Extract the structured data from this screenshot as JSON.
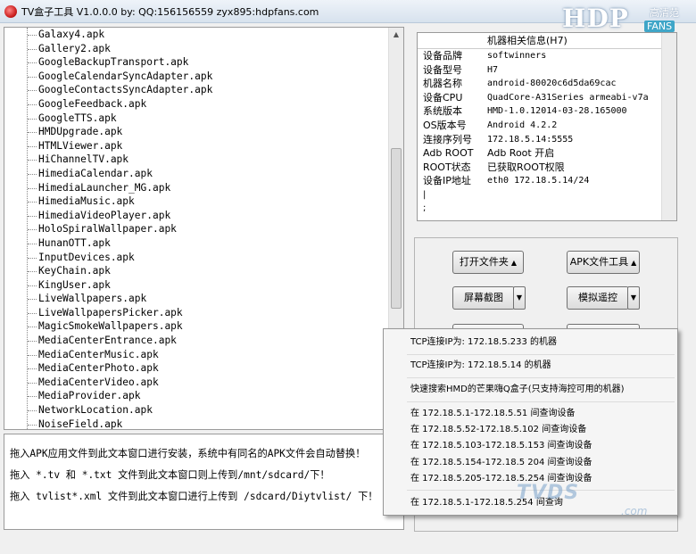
{
  "window": {
    "title": "TV盒子工具 V1.0.0.0 by: QQ:156156559  zyx895:hdpfans.com"
  },
  "logo": {
    "main": "HDP",
    "chinese": "高清范",
    "fans": "FANS"
  },
  "apk_list": [
    "Galaxy4.apk",
    "Gallery2.apk",
    "GoogleBackupTransport.apk",
    "GoogleCalendarSyncAdapter.apk",
    "GoogleContactsSyncAdapter.apk",
    "GoogleFeedback.apk",
    "GoogleTTS.apk",
    "HMDUpgrade.apk",
    "HTMLViewer.apk",
    "HiChannelTV.apk",
    "HimediaCalendar.apk",
    "HimediaLauncher_MG.apk",
    "HimediaMusic.apk",
    "HimediaVideoPlayer.apk",
    "HoloSpiralWallpaper.apk",
    "HunanOTT.apk",
    "InputDevices.apk",
    "KeyChain.apk",
    "KingUser.apk",
    "LiveWallpapers.apk",
    "LiveWallpapersPicker.apk",
    "MagicSmokeWallpapers.apk",
    "MediaCenterEntrance.apk",
    "MediaCenterMusic.apk",
    "MediaCenterPhoto.apk",
    "MediaCenterVideo.apk",
    "MediaProvider.apk",
    "NetworkLocation.apk",
    "NoiseField.apk"
  ],
  "instructions": {
    "line1": "拖入APK应用文件到此文本窗口进行安装，系统中有同名的APK文件会自动替换！",
    "line2": "拖入 *.tv 和 *.txt 文件到此文本窗口则上传到/mnt/sdcard/下！",
    "line3": "拖入 tvlist*.xml 文件到此文本窗口进行上传到 /sdcard/Diytvlist/ 下！"
  },
  "device_info": {
    "header": "机器相关信息(H7)",
    "rows": [
      {
        "label": "设备品牌",
        "value": "softwinners"
      },
      {
        "label": "设备型号",
        "value": "H7"
      },
      {
        "label": "机器名称",
        "value": "android-80020c6d5da69cac"
      },
      {
        "label": "设备CPU",
        "value": "QuadCore-A31Series  armeabi-v7a"
      },
      {
        "label": "系统版本",
        "value": "HMD-1.0.12014-03-28.165000"
      },
      {
        "label": "OS版本号",
        "value": "Android  4.2.2"
      },
      {
        "label": "连接序列号",
        "value": "172.18.5.14:5555"
      },
      {
        "label": "Adb ROOT",
        "value": "Adb Root 开启"
      },
      {
        "label": "ROOT状态",
        "value": "已获取ROOT权限"
      },
      {
        "label": "设备IP地址",
        "value": "eth0 172.18.5.14/24"
      }
    ],
    "extra1": "|",
    "extra2": ";"
  },
  "buttons": {
    "open_folder": "打开文件夹",
    "apk_tool": "APK文件工具",
    "screenshot": "屏幕截图",
    "remote": "模拟遥控"
  },
  "popup_menu": {
    "items": [
      "TCP连接IP为: 172.18.5.233 的机器",
      "TCP连接IP为: 172.18.5.14 的机器",
      "快速搜索HMD的芒果嗨Q盒子(只支持海控可用的机器)",
      "在 172.18.5.1-172.18.5.51 间查询设备",
      "在 172.18.5.52-172.18.5.102 间查询设备",
      "在 172.18.5.103-172.18.5.153 间查询设备",
      "在 172.18.5.154-172.18.5 204 间查询设备",
      "在 172.18.5.205-172.18.5.254 间查询设备",
      "在 172.18.5.1-172.18.5.254 间查询"
    ]
  },
  "watermark": {
    "text": "TVDS",
    "suffix": ".com"
  }
}
